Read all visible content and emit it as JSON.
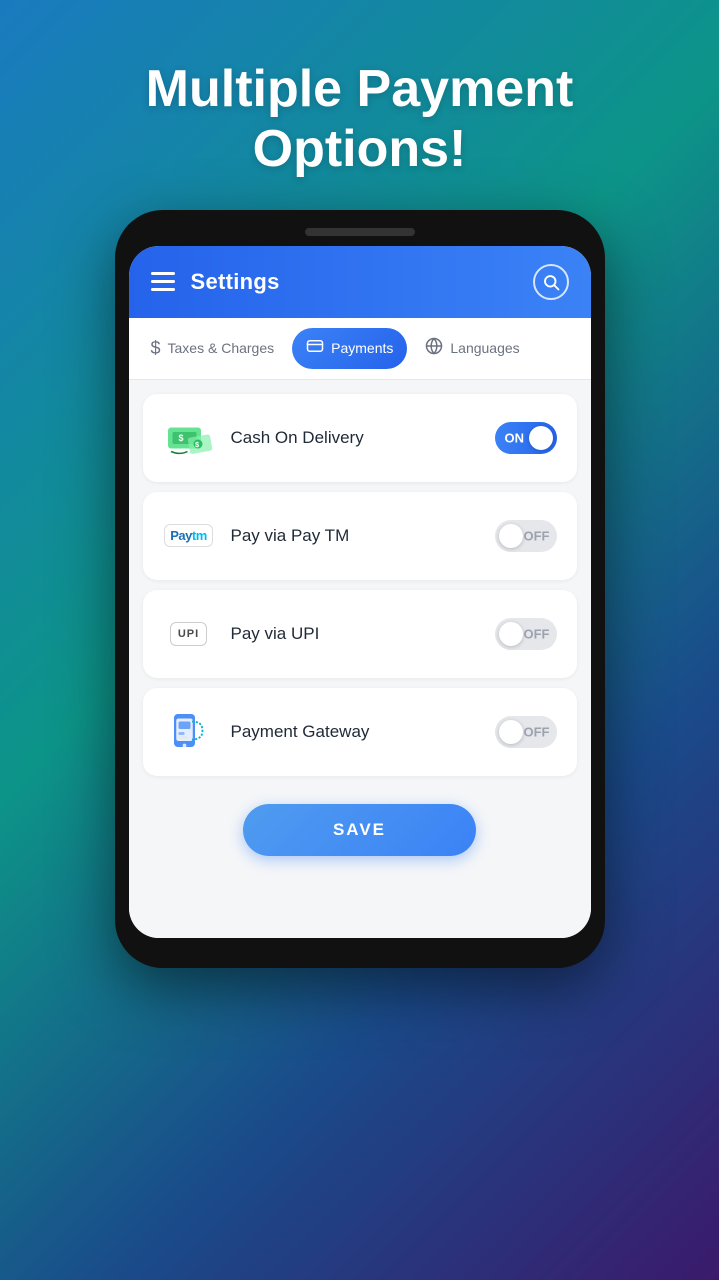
{
  "page": {
    "hero_title": "Multiple Payment Options!"
  },
  "header": {
    "title": "Settings",
    "search_label": "search"
  },
  "tabs": [
    {
      "id": "taxes",
      "label": "Taxes & Charges",
      "icon": "dollar-icon",
      "active": false
    },
    {
      "id": "payments",
      "label": "Payments",
      "icon": "payment-icon",
      "active": true
    },
    {
      "id": "languages",
      "label": "Languages",
      "icon": "language-icon",
      "active": false
    }
  ],
  "payments": [
    {
      "id": "cash-on-delivery",
      "label": "Cash On Delivery",
      "icon": "cash-icon",
      "enabled": true,
      "toggle_on_label": "ON",
      "toggle_off_label": "OFF"
    },
    {
      "id": "paytm",
      "label": "Pay via Pay TM",
      "icon": "paytm-icon",
      "enabled": false,
      "toggle_on_label": "ON",
      "toggle_off_label": "OFF"
    },
    {
      "id": "upi",
      "label": "Pay via UPI",
      "icon": "upi-icon",
      "enabled": false,
      "toggle_on_label": "ON",
      "toggle_off_label": "OFF"
    },
    {
      "id": "payment-gateway",
      "label": "Payment Gateway",
      "icon": "gateway-icon",
      "enabled": false,
      "toggle_on_label": "ON",
      "toggle_off_label": "OFF"
    }
  ],
  "save_button": {
    "label": "SAVE"
  }
}
